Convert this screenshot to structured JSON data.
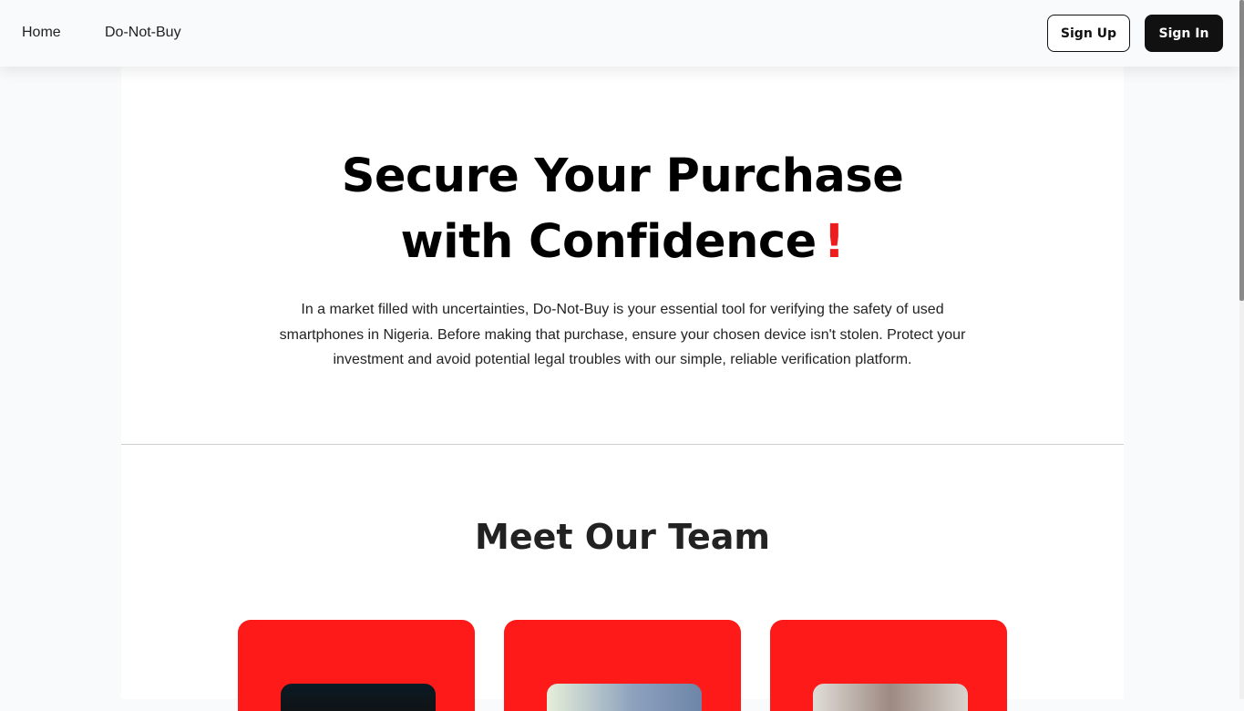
{
  "nav": {
    "home_label": "Home",
    "dnb_label": "Do-Not-Buy",
    "signup_label": "Sign Up",
    "signin_label": "Sign In"
  },
  "hero": {
    "title_line1": "Secure Your Purchase",
    "title_line2": "with Confidence",
    "title_exclamation": "!",
    "description": "In a market filled with uncertainties, Do-Not-Buy is your essential tool for verifying the safety of used smartphones in Nigeria. Before making that purchase, ensure your chosen device isn't stolen. Protect your investment and avoid potential legal troubles with our simple, reliable verification platform."
  },
  "team": {
    "title": "Meet Our Team"
  },
  "colors": {
    "accent_red": "#ff1a1a",
    "exclamation_red": "#ee1c1c",
    "dark_button": "#111111"
  }
}
